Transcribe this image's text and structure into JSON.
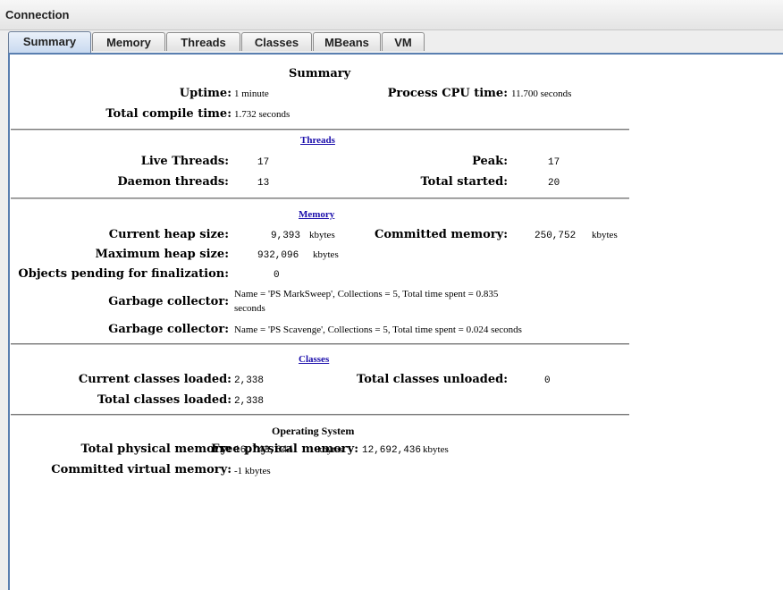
{
  "menu": {
    "connection": "Connection"
  },
  "tabs": [
    "Summary",
    "Memory",
    "Threads",
    "Classes",
    "MBeans",
    "VM"
  ],
  "summary": {
    "heading": "Summary",
    "uptime_label": "Uptime:",
    "uptime_value": "1 minute",
    "cpu_label": "Process CPU time:",
    "cpu_value": "11.700 seconds",
    "compile_label": "Total compile time:",
    "compile_value": "1.732 seconds"
  },
  "threads": {
    "heading": "Threads",
    "live_label": "Live Threads:",
    "live_value": "17",
    "peak_label": "Peak:",
    "peak_value": "17",
    "daemon_label": "Daemon threads:",
    "daemon_value": "13",
    "started_label": "Total started:",
    "started_value": "20"
  },
  "memory": {
    "heading": "Memory",
    "heap_label": "Current heap size:",
    "heap_value": "9,393",
    "heap_unit": "kbytes",
    "committed_label": "Committed memory:",
    "committed_value": "250,752",
    "committed_unit": "kbytes",
    "max_label": "Maximum heap size:",
    "max_value": "932,096",
    "max_unit": "kbytes",
    "pending_label": "Objects pending for finalization:",
    "pending_value": "0",
    "gc1_label": "Garbage collector:",
    "gc1_line1": "Name = 'PS MarkSweep', Collections = 5, Total time spent = 0.835",
    "gc1_line2": "seconds",
    "gc2_label": "Garbage collector:",
    "gc2_value": "Name = 'PS Scavenge', Collections = 5, Total time spent = 0.024 seconds"
  },
  "classes": {
    "heading": "Classes",
    "current_label": "Current classes loaded:",
    "current_value": "2,338",
    "unloaded_label": "Total classes unloaded:",
    "unloaded_value": "0",
    "total_label": "Total classes loaded:",
    "total_value": "2,338"
  },
  "os": {
    "heading": "Operating System",
    "phys_label": "Total physical memory:",
    "phys_value": "16,743,644",
    "phys_unit": "kbytes",
    "free_label": "Free physical memory:",
    "free_value": "12,692,436",
    "free_unit": "kbytes",
    "virt_label": "Committed virtual memory:",
    "virt_value": "-1 kbytes"
  }
}
